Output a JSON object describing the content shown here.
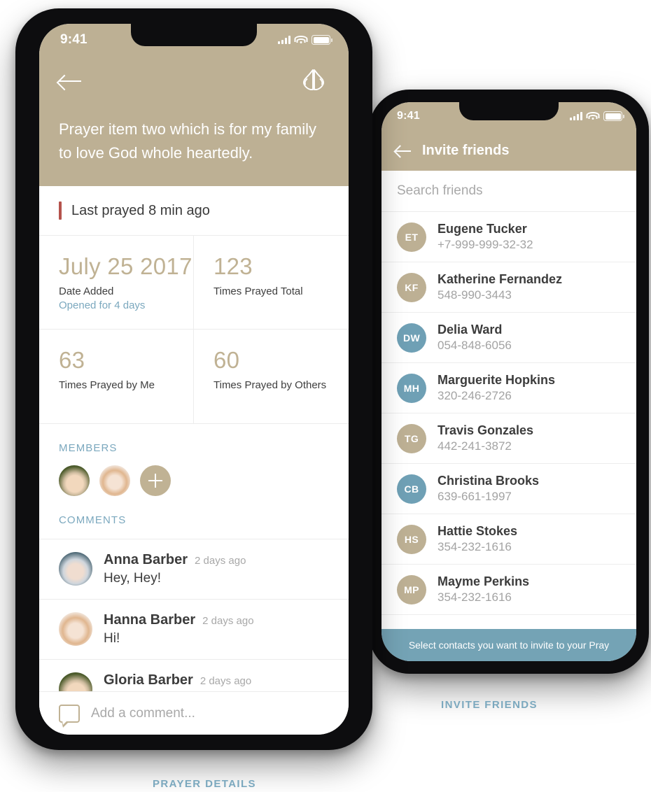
{
  "captions": {
    "left": "PRAYER DETAILS",
    "right": "INVITE FRIENDS"
  },
  "colors": {
    "tan": "#bdb094",
    "tan_text": "#c0b294",
    "blue": "#7ba8be",
    "banner_blue": "#74a3b5",
    "accent_red": "#b5534c"
  },
  "prayer_details": {
    "status_bar": {
      "time": "9:41",
      "signal_icon": "signal-bars-icon",
      "wifi_icon": "wifi-icon",
      "battery_icon": "battery-icon"
    },
    "header": {
      "back_icon": "back-arrow-icon",
      "praying_hands_icon": "praying-hands-icon",
      "title": "Prayer item two which is for my family to love God whole heartedly."
    },
    "last_prayed": "Last prayed 8 min ago",
    "stats": [
      {
        "value": "July 25 2017",
        "label": "Date Added",
        "sub": "Opened for 4 days"
      },
      {
        "value": "123",
        "label": "Times Prayed Total",
        "sub": ""
      },
      {
        "value": "63",
        "label": "Times Prayed by Me",
        "sub": ""
      },
      {
        "value": "60",
        "label": "Times Prayed by Others",
        "sub": ""
      }
    ],
    "members_title": "MEMBERS",
    "members": [
      {
        "name": "member-1",
        "style": "ph-green"
      },
      {
        "name": "member-2",
        "style": "ph-cream"
      }
    ],
    "add_member_label": "add-member",
    "comments_title": "COMMENTS",
    "comments": [
      {
        "name": "Anna Barber",
        "time": "2 days ago",
        "text": "Hey, Hey!",
        "style": "ph-blue"
      },
      {
        "name": "Hanna Barber",
        "time": "2 days ago",
        "text": "Hi!",
        "style": "ph-cream"
      },
      {
        "name": "Gloria Barber",
        "time": "2 days ago",
        "text": "",
        "style": "ph-green"
      }
    ],
    "composer": {
      "icon": "comment-bubble-icon",
      "placeholder": "Add a comment..."
    }
  },
  "invite_friends": {
    "status_bar": {
      "time": "9:41",
      "signal_icon": "signal-bars-icon",
      "wifi_icon": "wifi-icon",
      "battery_icon": "battery-icon"
    },
    "header": {
      "back_icon": "back-arrow-icon",
      "title": "Invite friends"
    },
    "search": {
      "placeholder": "Search friends"
    },
    "contacts": [
      {
        "initials": "ET",
        "name": "Eugene Tucker",
        "phone": "+7-999-999-32-32",
        "color": "#bdb094"
      },
      {
        "initials": "KF",
        "name": "Katherine Fernandez",
        "phone": "548-990-3443",
        "color": "#bdb094"
      },
      {
        "initials": "DW",
        "name": "Delia Ward",
        "phone": "054-848-6056",
        "color": "#6fa0b5"
      },
      {
        "initials": "MH",
        "name": "Marguerite Hopkins",
        "phone": "320-246-2726",
        "color": "#6fa0b5"
      },
      {
        "initials": "TG",
        "name": "Travis Gonzales",
        "phone": "442-241-3872",
        "color": "#bdb094"
      },
      {
        "initials": "CB",
        "name": "Christina Brooks",
        "phone": "639-661-1997",
        "color": "#6fa0b5"
      },
      {
        "initials": "HS",
        "name": "Hattie Stokes",
        "phone": "354-232-1616",
        "color": "#bdb094"
      },
      {
        "initials": "MP",
        "name": "Mayme Perkins",
        "phone": "354-232-1616",
        "color": "#bdb094"
      }
    ],
    "banner": "Select contacts you want to invite to your Pray"
  }
}
